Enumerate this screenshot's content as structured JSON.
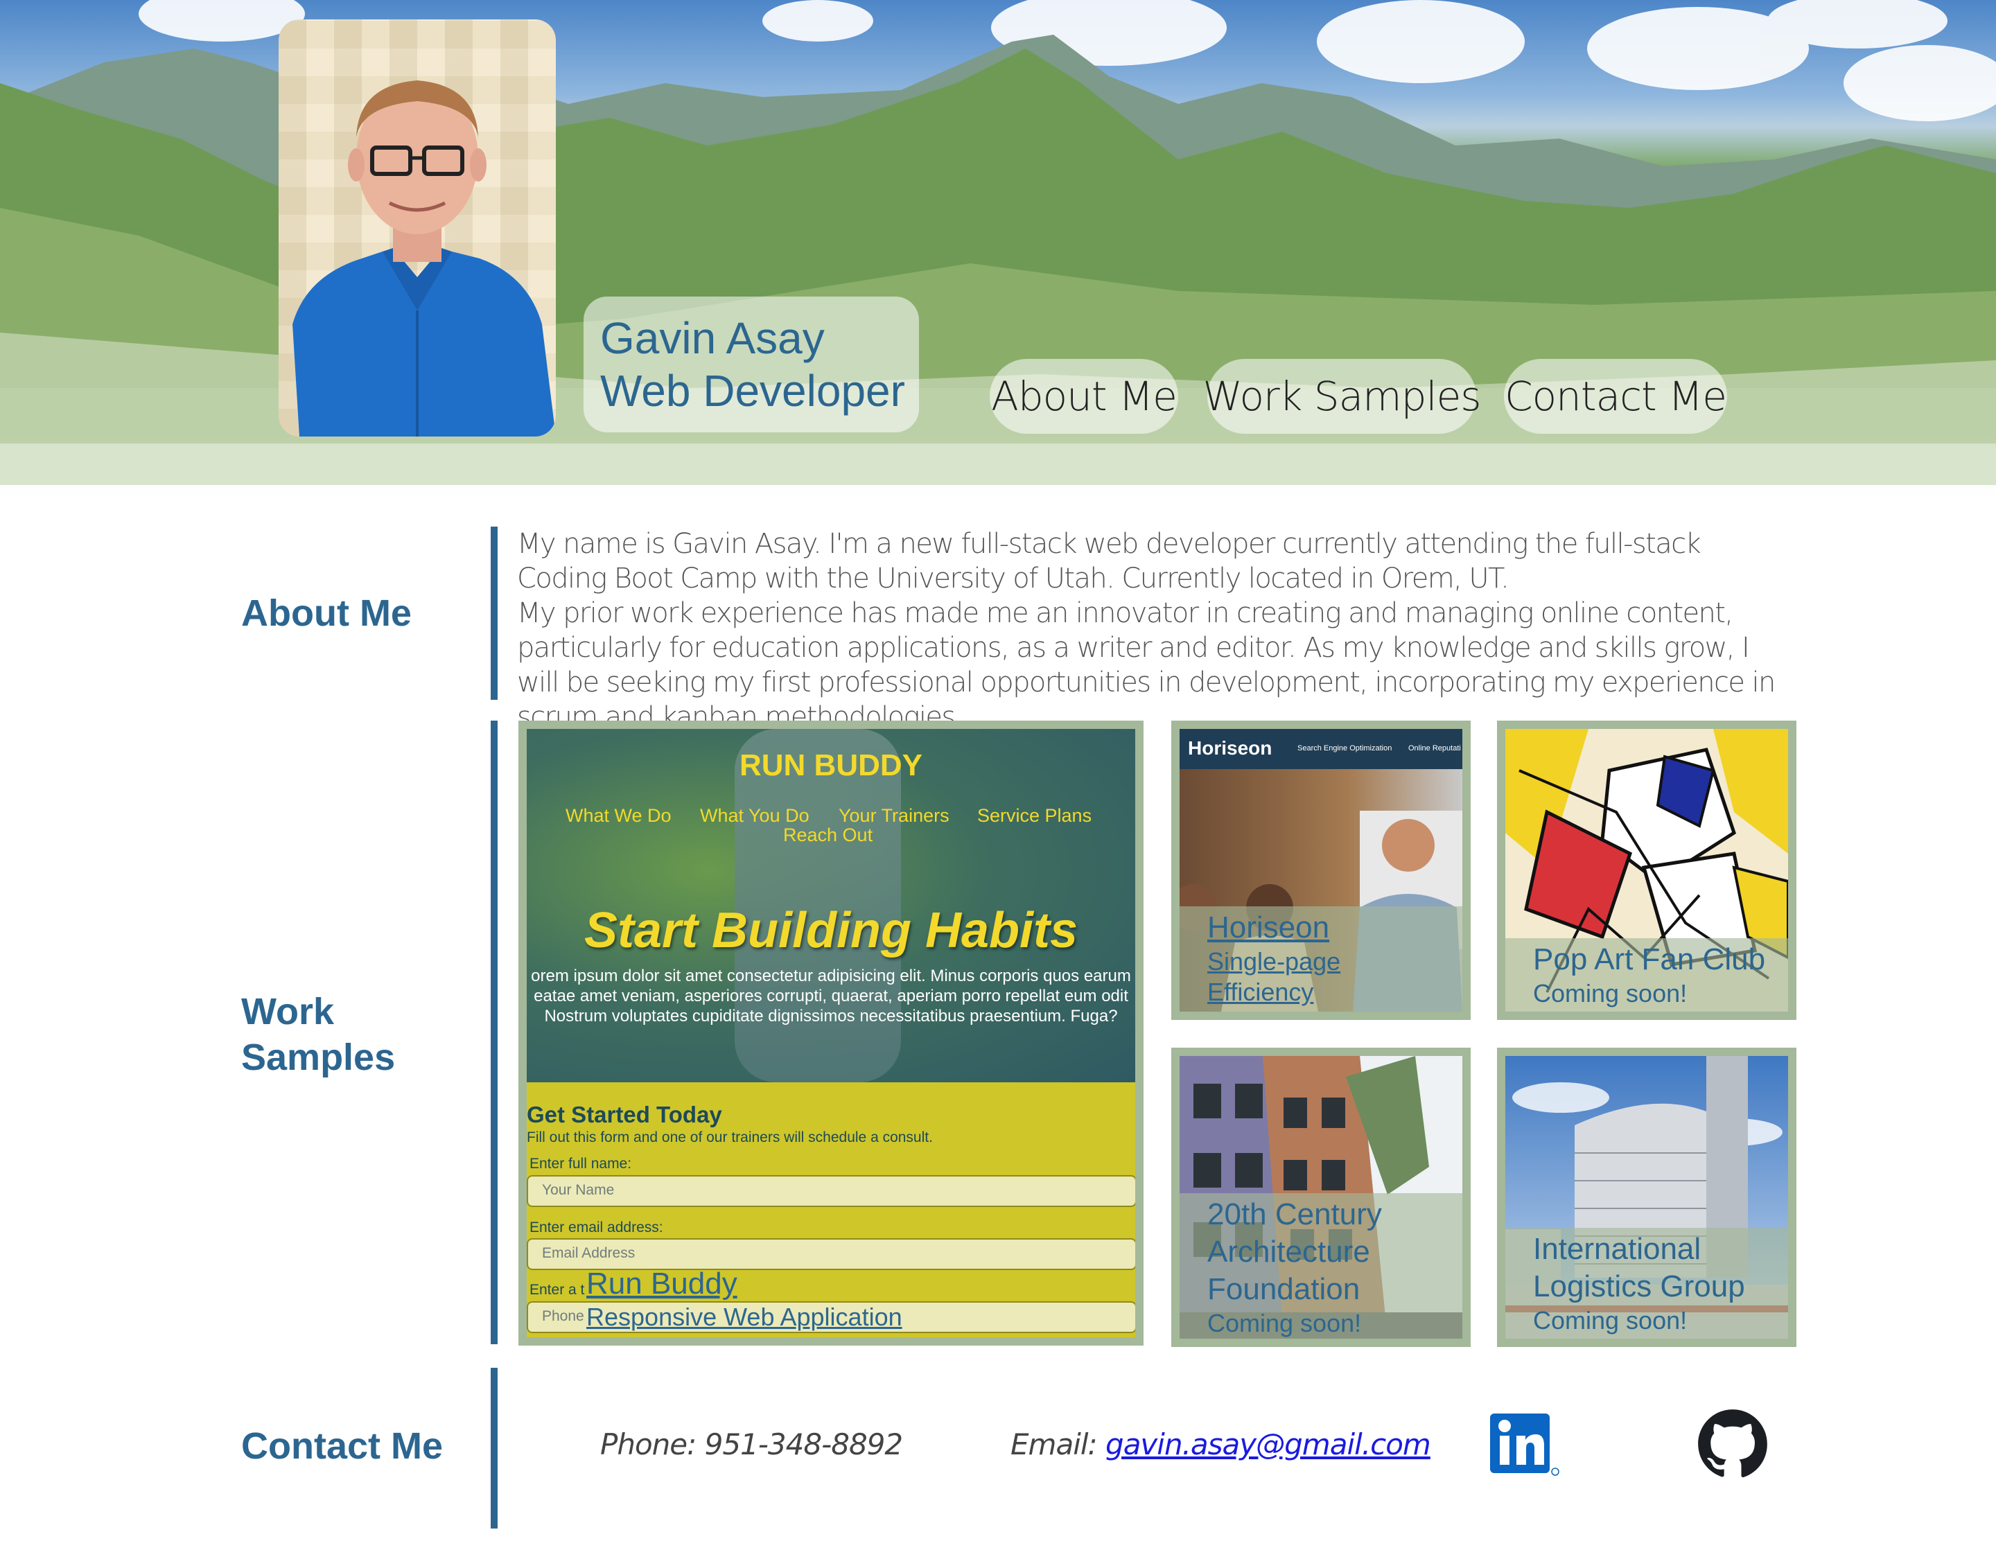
{
  "header": {
    "name": "Gavin Asay",
    "title": "Web Developer",
    "nav": [
      {
        "label": "About Me"
      },
      {
        "label": "Work Samples"
      },
      {
        "label": "Contact Me"
      }
    ]
  },
  "about": {
    "heading": "About Me",
    "paragraph1": "My name is Gavin Asay. I'm a new full-stack web developer currently attending the full-stack Coding Boot Camp with the University of Utah. Currently located in Orem, UT.",
    "paragraph2": "My prior work experience has made me an innovator in creating and managing online content, particularly for education applications, as a writer and editor. As my knowledge and skills grow, I will be seeking my first professional opportunities in development, incorporating my experience in scrum and kanban methodologies."
  },
  "work": {
    "heading_line1": "Work",
    "heading_line2": "Samples",
    "featured": {
      "title": "Run Buddy",
      "subtitle": "Responsive Web Application",
      "preview": {
        "brand": "RUN BUDDY",
        "nav": [
          "What We Do",
          "What You Do",
          "Your Trainers",
          "Service Plans",
          "Reach Out"
        ],
        "hero": "Start Building Habits",
        "lorem_line1": "orem ipsum dolor sit amet consectetur adipisicing elit. Minus corporis quos earum",
        "lorem_line2": "eatae amet veniam, asperiores corrupti, quaerat, aperiam porro repellat eum odit",
        "lorem_line3": "Nostrum voluptates cupiditate dignissimos necessitatibus praesentium. Fuga?",
        "form_title": "Get Started Today",
        "form_intro": "Fill out this form and one of our trainers will schedule a consult.",
        "label_name": "Enter full name:",
        "placeholder_name": "Your Name",
        "label_email": "Enter email address:",
        "placeholder_email": "Email Address",
        "label_phone": "Enter a t",
        "placeholder_phone": "Phone"
      }
    },
    "cards": [
      {
        "title": "Horiseon",
        "subtitle": "Single-page Efficiency",
        "brand": "Horiseon",
        "menu1": "Search Engine Optimization",
        "menu2": "Online Reputati"
      },
      {
        "title": "Pop Art Fan Club",
        "subtitle": "Coming soon!"
      },
      {
        "title_line1": "20th Century",
        "title_line2": "Architecture",
        "title_line3": "Foundation",
        "subtitle": "Coming soon!"
      },
      {
        "title_line1": "International",
        "title_line2": "Logistics Group",
        "subtitle": "Coming soon!"
      }
    ]
  },
  "contact": {
    "heading": "Contact Me",
    "phone_label": "Phone: 951-348-8892",
    "email_label": "Email: ",
    "email": "gavin.asay@gmail.com",
    "linkedin_icon": "linkedin-icon",
    "github_icon": "github-icon"
  },
  "colors": {
    "accent": "#2c6690",
    "card_border": "#a4b89a",
    "link": "#1a1ae0"
  }
}
